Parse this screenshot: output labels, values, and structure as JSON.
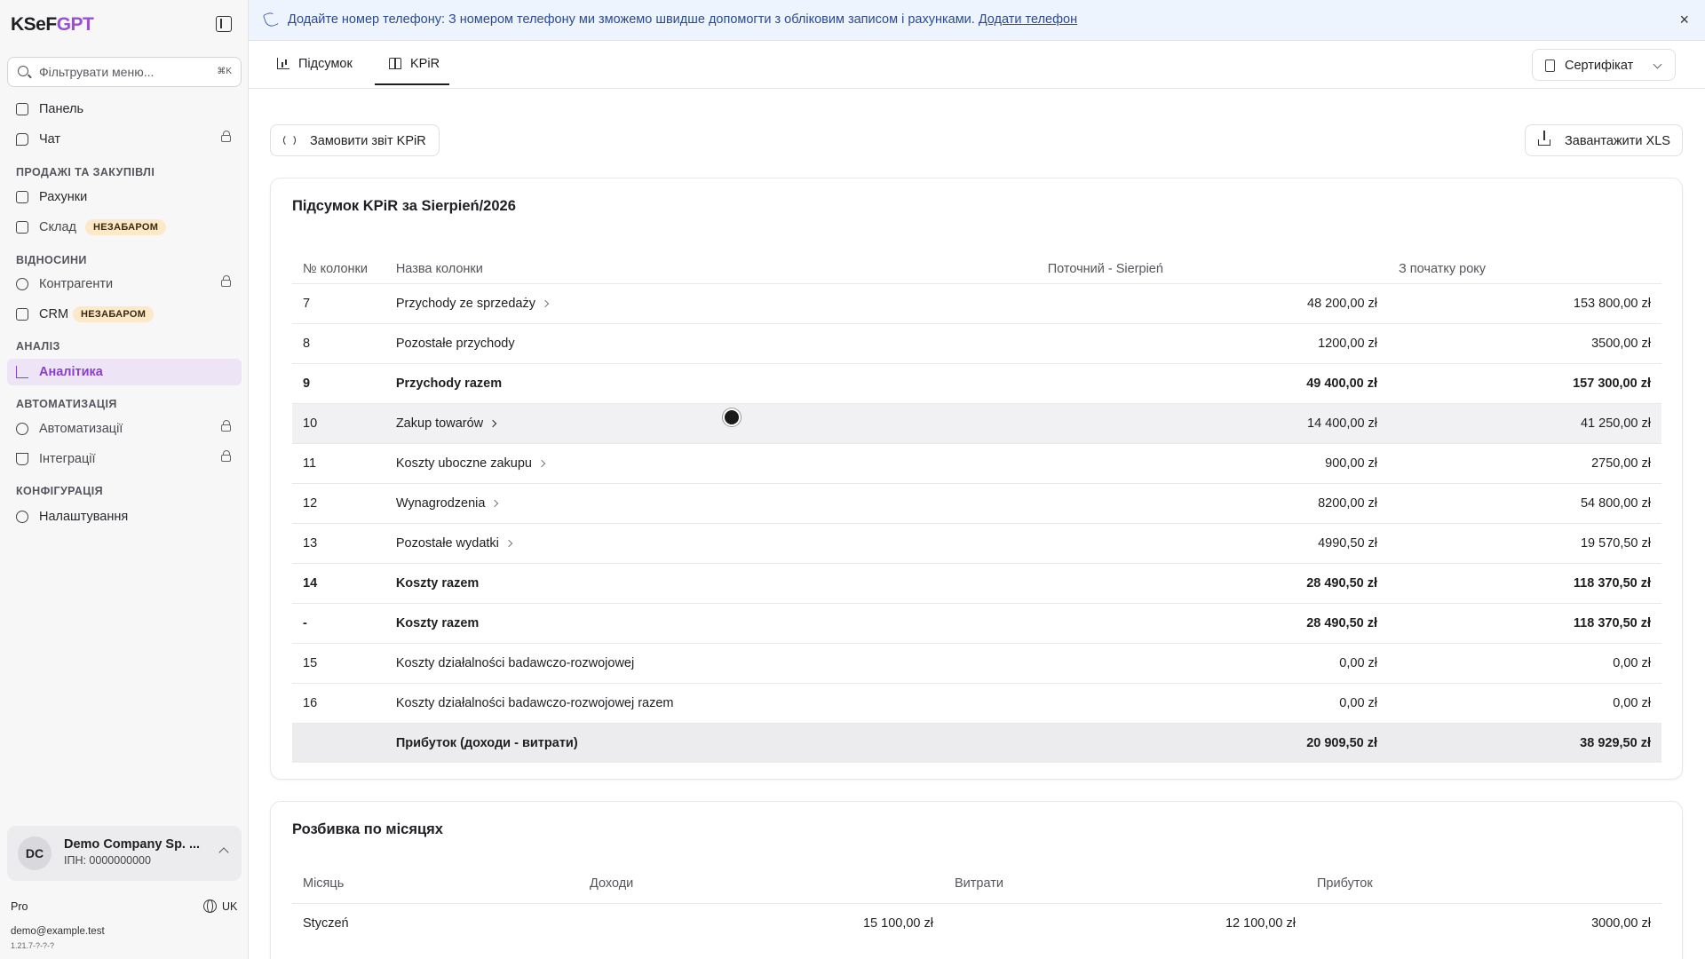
{
  "app": {
    "logo_ksef": "KSeF",
    "logo_gpt": "GPT"
  },
  "sidebar": {
    "filter_placeholder": "Фільтрувати меню...",
    "filter_shortcut": "⌘K",
    "items": {
      "panel": "Панель",
      "chat": "Чат",
      "invoices": "Рахунки",
      "warehouse": "Склад",
      "contractors": "Контрагенти",
      "crm": "CRM",
      "analytics": "Аналітика",
      "automation": "Автоматизації",
      "integrations": "Інтеграції",
      "settings": "Налаштування"
    },
    "sections": {
      "sales": "ПРОДАЖІ ТА ЗАКУПІВЛІ",
      "relations": "ВІДНОСИНИ",
      "analysis": "АНАЛІЗ",
      "automation": "АВТОМАТИЗАЦІЯ",
      "config": "КОНФІГУРАЦІЯ"
    },
    "soon_badge": "НЕЗАБАРОМ",
    "company": {
      "initials": "DC",
      "name": "Demo Company Sp. ...",
      "nip": "ІПН: 0000000000"
    },
    "plan": "Pro",
    "language": "UK",
    "email": "demo@example.test",
    "version": "1.21.7-?-?-?"
  },
  "banner": {
    "message": "Додайте номер телефону: З номером телефону ми зможемо швидше допомогти з обліковим записом і рахунками.",
    "link": "Додати телефон",
    "close": "×"
  },
  "tabs": {
    "summary": "Підсумок",
    "kpir": "KPiR",
    "certificate": "Сертифікат"
  },
  "actions": {
    "order_report": "Замовити звіт KPiR",
    "download_xls": "Завантажити XLS"
  },
  "summary": {
    "title": "Підсумок KPiR за Sierpień/2026",
    "headers": {
      "col_no": "№ колонки",
      "name": "Назва колонки",
      "current": "Поточний - Sierpień",
      "ytd": "З початку року"
    },
    "rows": [
      {
        "no": "7",
        "name": "Przychody ze sprzedaży",
        "current": "48 200,00 zł",
        "ytd": "153 800,00 zł"
      },
      {
        "no": "8",
        "name": "Pozostałe przychody",
        "current": "1200,00 zł",
        "ytd": "3500,00 zł"
      },
      {
        "no": "9",
        "name": "Przychody razem",
        "current": "49 400,00 zł",
        "ytd": "157 300,00 zł"
      },
      {
        "no": "10",
        "name": "Zakup towarów",
        "current": "14 400,00 zł",
        "ytd": "41 250,00 zł"
      },
      {
        "no": "11",
        "name": "Koszty uboczne zakupu",
        "current": "900,00 zł",
        "ytd": "2750,00 zł"
      },
      {
        "no": "12",
        "name": "Wynagrodzenia",
        "current": "8200,00 zł",
        "ytd": "54 800,00 zł"
      },
      {
        "no": "13",
        "name": "Pozostałe wydatki",
        "current": "4990,50 zł",
        "ytd": "19 570,50 zł"
      },
      {
        "no": "14",
        "name": "Koszty razem",
        "current": "28 490,50 zł",
        "ytd": "118 370,50 zł"
      },
      {
        "no": "-",
        "name": "Koszty razem",
        "current": "28 490,50 zł",
        "ytd": "118 370,50 zł"
      },
      {
        "no": "15",
        "name": "Koszty działalności badawczo-rozwojowej",
        "current": "0,00 zł",
        "ytd": "0,00 zł"
      },
      {
        "no": "16",
        "name": "Koszty działalności badawczo-rozwojowej razem",
        "current": "0,00 zł",
        "ytd": "0,00 zł"
      },
      {
        "no": "",
        "name": "Прибуток (доходи - витрати)",
        "current": "20 909,50 zł",
        "ytd": "38 929,50 zł"
      }
    ]
  },
  "monthly": {
    "title": "Розбивка по місяцях",
    "headers": {
      "month": "Місяць",
      "income": "Доходи",
      "expenses": "Витрати",
      "profit": "Прибуток"
    },
    "rows": [
      {
        "month": "Styczeń",
        "income": "15 100,00 zł",
        "expenses": "12 100,00 zł",
        "profit": "3000,00 zł"
      }
    ]
  }
}
